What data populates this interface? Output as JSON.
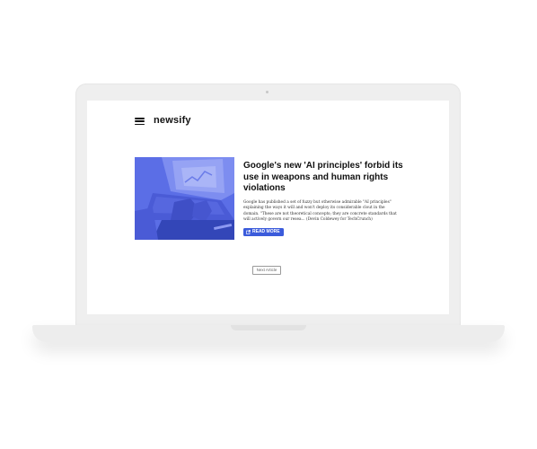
{
  "app": {
    "brand": "newsify"
  },
  "icons": {
    "menu": "hamburger-menu-icon",
    "theme": "moon-icon",
    "read_more": "external-link-icon"
  },
  "colors": {
    "accent": "#3b5bdb",
    "thumbnail_tint": "#5b6ee6"
  },
  "article": {
    "headline": "Google's new 'AI principles' forbid its use in weapons and human rights violations",
    "excerpt": "Google has published a set of fuzzy but otherwise admirable \"AI principles\" explaining the ways it will and won't deploy its considerable clout in the domain. \"These are not theoretical concepts; they are concrete standards that will actively govern our resea... (Devin Coldewey for TechCrunch)",
    "read_more_label": "READ MORE"
  },
  "pagination": {
    "next_label": "Next Article"
  }
}
